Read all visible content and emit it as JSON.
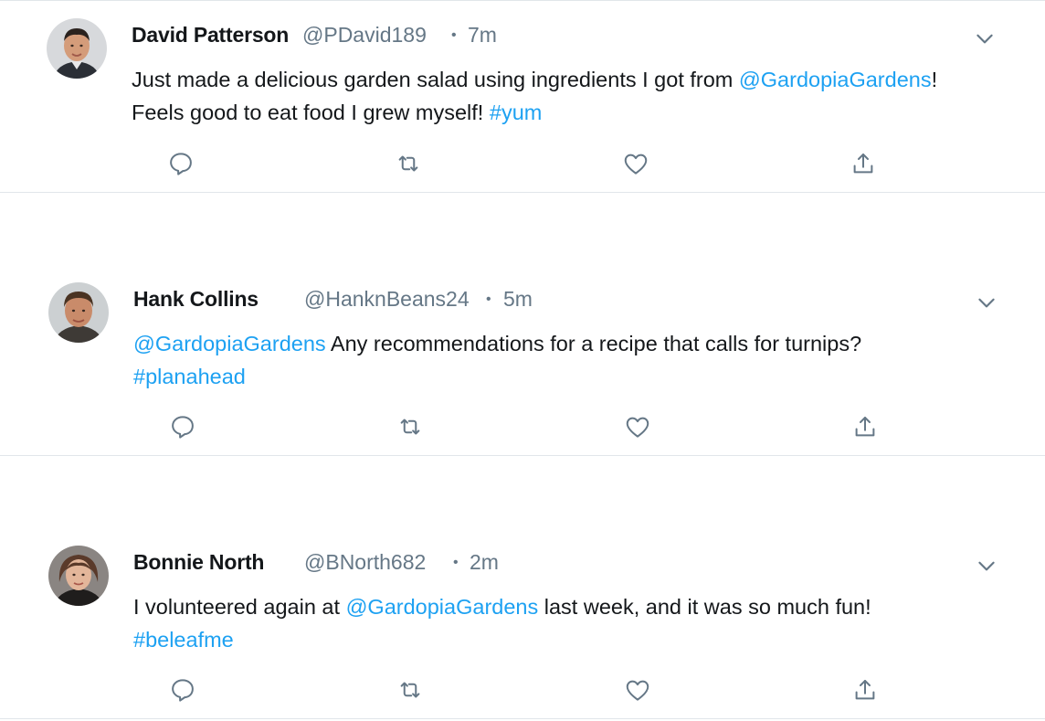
{
  "tweets": [
    {
      "name": "David Patterson",
      "handle": "@PDavid189",
      "sep": "•",
      "time": "7m",
      "line1": {
        "pre": "Just made a delicious garden salad using ingredients I got from ",
        "mention": "@GardopiaGardens",
        "post": "!"
      },
      "line2": {
        "pre": "Feels good to eat food I grew myself! ",
        "hashtag": "#yum"
      }
    },
    {
      "name": "Hank Collins",
      "handle": "@HanknBeans24",
      "sep": "•",
      "time": "5m",
      "line1": {
        "mention": "@GardopiaGardens",
        "post": " Any recommendations for a recipe that calls for turnips?"
      },
      "line2": {
        "hashtag": "#planahead"
      }
    },
    {
      "name": "Bonnie North",
      "handle": "@BNorth682",
      "sep": "•",
      "time": "2m",
      "line1": {
        "pre": "I volunteered again at ",
        "mention": "@GardopiaGardens",
        "post": " last week, and it was so much fun!"
      },
      "line2": {
        "hashtag": "#beleafme"
      }
    }
  ],
  "icons": {
    "reply": "reply-icon",
    "retweet": "retweet-icon",
    "like": "like-icon",
    "share": "share-icon",
    "more": "chevron-down-icon"
  },
  "colors": {
    "link": "#1da1f2",
    "secondary_text": "#657786",
    "primary_text": "#14171a",
    "divider": "#e1e6ea"
  }
}
